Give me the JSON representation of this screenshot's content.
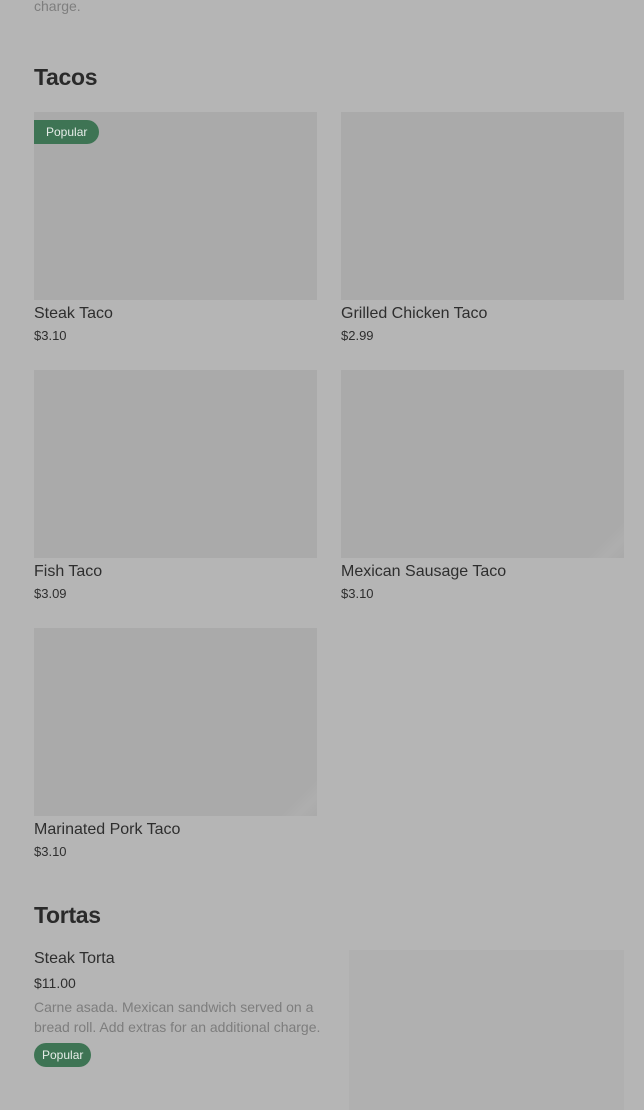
{
  "top_description_tail": "charge.",
  "sections": {
    "tacos": {
      "title": "Tacos",
      "items": [
        {
          "name": "Steak Taco",
          "price": "$3.10",
          "badge": "Popular"
        },
        {
          "name": "Grilled Chicken Taco",
          "price": "$2.99"
        },
        {
          "name": "Fish Taco",
          "price": "$3.09"
        },
        {
          "name": "Mexican Sausage Taco",
          "price": "$3.10"
        },
        {
          "name": "Marinated Pork Taco",
          "price": "$3.10"
        }
      ]
    },
    "tortas": {
      "title": "Tortas",
      "items": [
        {
          "name": "Steak Torta",
          "price": "$11.00",
          "description": "Carne asada. Mexican sandwich served on a bread roll. Add extras for an additional charge.",
          "badge": "Popular"
        }
      ]
    }
  },
  "colors": {
    "background": "#b5b5b5",
    "badge": "#3e7454",
    "image_placeholder": "#aaaaaa"
  }
}
